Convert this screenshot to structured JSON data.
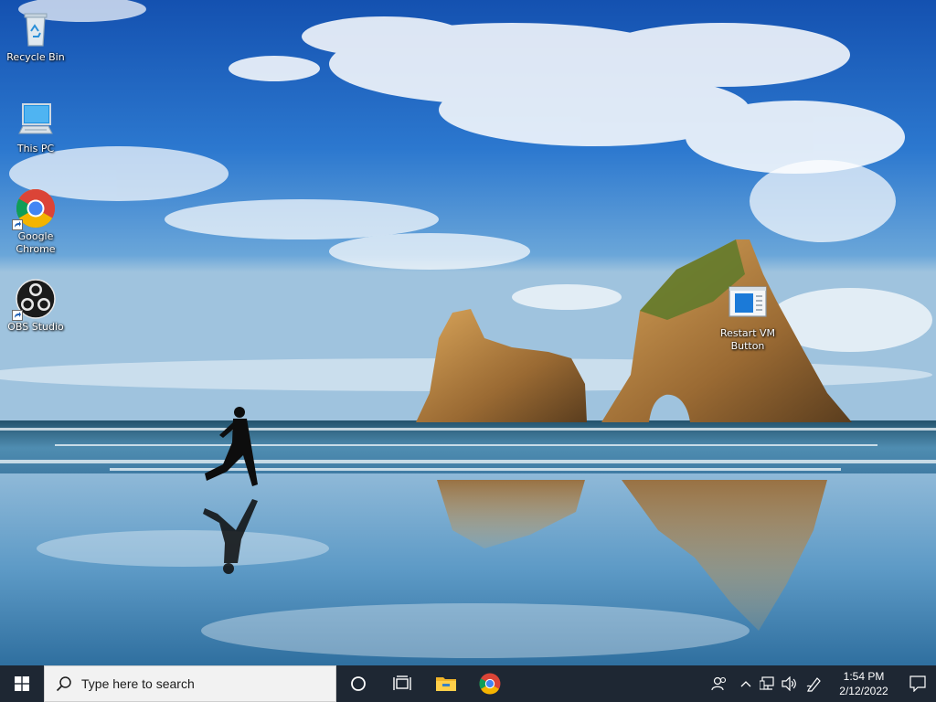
{
  "desktop": {
    "icons": [
      {
        "id": "recycle-bin",
        "label": "Recycle Bin"
      },
      {
        "id": "this-pc",
        "label": "This PC"
      },
      {
        "id": "chrome",
        "label": "Google\nChrome"
      },
      {
        "id": "obs",
        "label": "OBS Studio"
      },
      {
        "id": "restart-vm",
        "label": "Restart VM\nButton"
      }
    ]
  },
  "taskbar": {
    "search_placeholder": "Type here to search",
    "pinned": [
      "cortana-icon",
      "task-view-icon",
      "file-explorer-icon",
      "chrome-icon"
    ],
    "tray_icons": [
      "people-icon",
      "show-hidden-icons-chevron",
      "network-icon",
      "volume-icon",
      "pen-icon"
    ],
    "clock": {
      "time": "1:54 PM",
      "date": "2/12/2022"
    }
  },
  "colors": {
    "taskbar_bg": "#1e2733",
    "search_bg": "#f2f2f2",
    "sky_top": "#1554b3",
    "sea": "#3e7fa8"
  }
}
